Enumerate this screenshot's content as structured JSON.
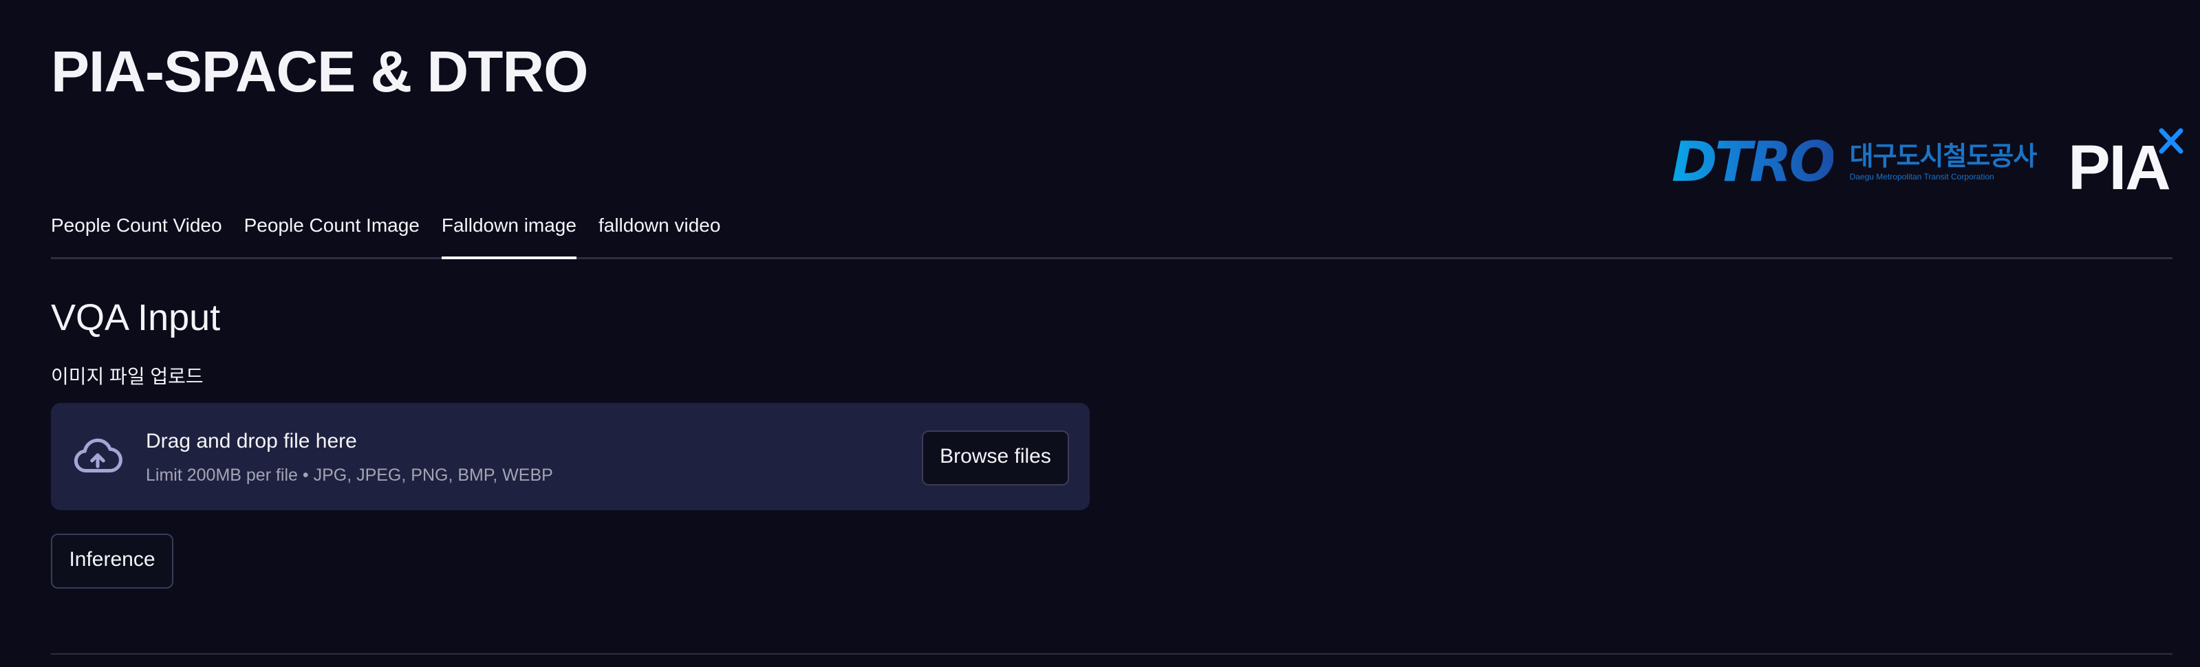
{
  "header": {
    "title": "PIA-SPACE & DTRO"
  },
  "logos": {
    "dtro": {
      "word": "DTRO",
      "korean": "대구도시철도공사",
      "english": "Daegu Metropolitan Transit Corporation"
    },
    "pia": {
      "word": "PIA"
    }
  },
  "tabs": [
    {
      "label": "People Count Video",
      "active": false
    },
    {
      "label": "People Count Image",
      "active": false
    },
    {
      "label": "Falldown image",
      "active": true
    },
    {
      "label": "falldown video",
      "active": false
    }
  ],
  "main": {
    "subheader": "VQA Input",
    "uploader": {
      "label": "이미지 파일 업로드",
      "drag_text": "Drag and drop file here",
      "limit_text": "Limit 200MB per file • JPG, JPEG, PNG, BMP, WEBP",
      "browse_label": "Browse files",
      "icon": "cloud-upload-icon"
    },
    "inference_label": "Inference"
  },
  "colors": {
    "background": "#0b0b1a",
    "dropzone": "#1f2140",
    "dtro_blue": "#1b74c6",
    "pia_accent": "#1a8cff"
  }
}
